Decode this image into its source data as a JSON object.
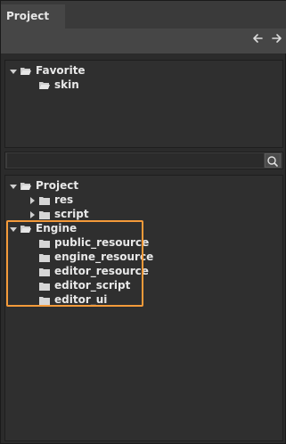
{
  "window": {
    "tab_label": "Project"
  },
  "nav": {
    "back_icon": "arrow-left-icon",
    "forward_icon": "arrow-right-icon"
  },
  "favorites": {
    "root_label": "Favorite",
    "items": [
      "skin"
    ]
  },
  "search": {
    "value": "",
    "icon": "magnifier-icon"
  },
  "tree": {
    "project": {
      "label": "Project",
      "children": [
        "res",
        "script"
      ]
    },
    "engine": {
      "label": "Engine",
      "children": [
        "public_resource",
        "engine_resource",
        "editor_resource",
        "editor_script",
        "editor_ui"
      ]
    }
  },
  "colors": {
    "highlight": "#f39a3a",
    "background": "#2b2b2b",
    "panel": "#2f2f2f",
    "text": "#e8e8e8"
  }
}
